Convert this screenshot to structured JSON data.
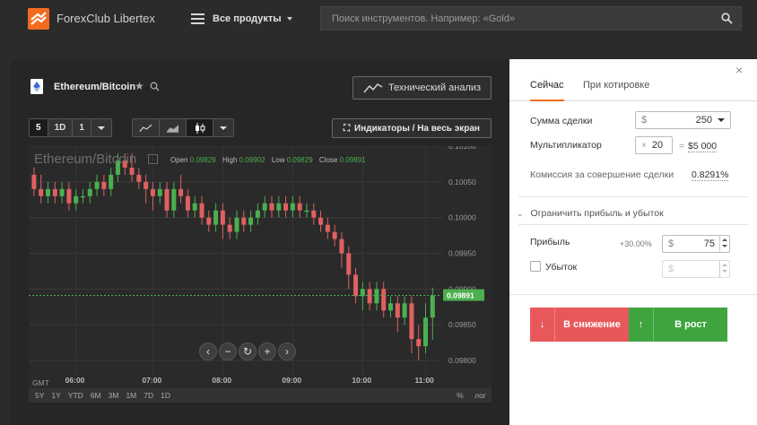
{
  "header": {
    "brand": "ForexClub Libertex",
    "products_label": "Все продукты",
    "search_placeholder": "Поиск инструментов. Например: «Gold»"
  },
  "instrument": {
    "name": "Ethereum/Bitcoin",
    "tech_analysis_label": "Технический анализ",
    "indicators_label": "Индикаторы / На весь экран"
  },
  "timeframes": [
    "5",
    "1D",
    "1"
  ],
  "chart": {
    "watermark": "Ethereum/Bitcoin",
    "ohlc": {
      "open_label": "Open",
      "open": "0.09829",
      "high_label": "High",
      "high": "0.09902",
      "low_label": "Low",
      "low": "0.09829",
      "close_label": "Close",
      "close": "0.09891"
    },
    "gmt_label": "GMT",
    "ranges": [
      "5Y",
      "1Y",
      "YTD",
      "6M",
      "3M",
      "1M",
      "7D",
      "1D"
    ],
    "right_controls": [
      "%",
      "лог"
    ],
    "colors": {
      "up": "#4caf50",
      "down": "#e06060",
      "last_price_line": "#4caf50"
    }
  },
  "chart_data": {
    "type": "candlestick",
    "title": "Ethereum/Bitcoin",
    "y_ticks": [
      "0.10100",
      "0.10050",
      "0.10000",
      "0.09950",
      "0.09900",
      "0.09850",
      "0.09800"
    ],
    "x_ticks": [
      "06:00",
      "07:00",
      "08:00",
      "09:00",
      "10:00",
      "11:00"
    ],
    "ylim": [
      0.0978,
      0.101
    ],
    "last_price": "0.09891",
    "grid": true,
    "candles": [
      [
        0.1006,
        0.1004,
        0.1007,
        0.1003
      ],
      [
        0.1004,
        0.1003,
        0.1006,
        0.1002
      ],
      [
        0.1003,
        0.1004,
        0.1005,
        0.1002
      ],
      [
        0.1004,
        0.1003,
        0.1005,
        0.1002
      ],
      [
        0.1003,
        0.1004,
        0.1005,
        0.1002
      ],
      [
        0.1004,
        0.1002,
        0.1005,
        0.1001
      ],
      [
        0.1002,
        0.1003,
        0.1004,
        0.1001
      ],
      [
        0.1003,
        0.1003,
        0.1004,
        0.1002
      ],
      [
        0.1003,
        0.1004,
        0.1005,
        0.1002
      ],
      [
        0.1004,
        0.1005,
        0.1006,
        0.1003
      ],
      [
        0.1005,
        0.1004,
        0.1006,
        0.1003
      ],
      [
        0.1004,
        0.1006,
        0.1007,
        0.1003
      ],
      [
        0.1006,
        0.1008,
        0.1009,
        0.1005
      ],
      [
        0.1008,
        0.1007,
        0.1009,
        0.1006
      ],
      [
        0.1007,
        0.1006,
        0.1009,
        0.1005
      ],
      [
        0.1006,
        0.1005,
        0.1007,
        0.1004
      ],
      [
        0.1005,
        0.1004,
        0.1006,
        0.1002
      ],
      [
        0.1004,
        0.1003,
        0.1005,
        0.1001
      ],
      [
        0.1003,
        0.1004,
        0.1005,
        0.1002
      ],
      [
        0.1004,
        0.1001,
        0.1005,
        0.1
      ],
      [
        0.1001,
        0.1004,
        0.1005,
        0.1
      ],
      [
        0.1004,
        0.1003,
        0.1006,
        0.1002
      ],
      [
        0.1003,
        0.1001,
        0.1004,
        0.1
      ],
      [
        0.1001,
        0.1002,
        0.1003,
        0.1
      ],
      [
        0.1002,
        0.1,
        0.1003,
        0.0999
      ],
      [
        0.1,
        0.0999,
        0.1001,
        0.0998
      ],
      [
        0.0999,
        0.1001,
        0.1002,
        0.0998
      ],
      [
        0.1001,
        0.0999,
        0.1002,
        0.0997
      ],
      [
        0.0999,
        0.0998,
        0.1,
        0.0997
      ],
      [
        0.0998,
        0.1,
        0.1001,
        0.0997
      ],
      [
        0.1,
        0.0999,
        0.1001,
        0.0998
      ],
      [
        0.0999,
        0.1,
        0.1001,
        0.0998
      ],
      [
        0.1,
        0.1001,
        0.1002,
        0.0999
      ],
      [
        0.1001,
        0.1002,
        0.1003,
        0.1
      ],
      [
        0.1002,
        0.1001,
        0.1003,
        0.1
      ],
      [
        0.1001,
        0.1002,
        0.1003,
        0.1
      ],
      [
        0.1002,
        0.1001,
        0.1003,
        0.1
      ],
      [
        0.1001,
        0.1002,
        0.1003,
        0.1
      ],
      [
        0.1002,
        0.1001,
        0.1003,
        0.1
      ],
      [
        0.1001,
        0.1001,
        0.1002,
        0.1
      ],
      [
        0.1001,
        0.1,
        0.1002,
        0.0999
      ],
      [
        0.1,
        0.0999,
        0.1001,
        0.0998
      ],
      [
        0.0999,
        0.0998,
        0.1,
        0.0997
      ],
      [
        0.0998,
        0.0997,
        0.0999,
        0.0996
      ],
      [
        0.0997,
        0.0995,
        0.0998,
        0.0993
      ],
      [
        0.0995,
        0.0992,
        0.0996,
        0.099
      ],
      [
        0.0992,
        0.0989,
        0.0993,
        0.0988
      ],
      [
        0.0989,
        0.099,
        0.0991,
        0.0987
      ],
      [
        0.099,
        0.0988,
        0.0991,
        0.0987
      ],
      [
        0.0988,
        0.099,
        0.0991,
        0.0987
      ],
      [
        0.099,
        0.0987,
        0.0991,
        0.0986
      ],
      [
        0.0987,
        0.0988,
        0.0989,
        0.0986
      ],
      [
        0.0988,
        0.0986,
        0.0989,
        0.0984
      ],
      [
        0.0986,
        0.0988,
        0.0989,
        0.0985
      ],
      [
        0.0988,
        0.0983,
        0.0989,
        0.0981
      ],
      [
        0.0983,
        0.0982,
        0.0985,
        0.098
      ],
      [
        0.0982,
        0.0986,
        0.0988,
        0.0981
      ],
      [
        0.0986,
        0.09891,
        0.09902,
        0.09829
      ]
    ]
  },
  "nav_controls": [
    "‹",
    "−",
    "↻",
    "+",
    "›"
  ],
  "trade": {
    "tab_now": "Сейчас",
    "tab_quote": "При котировке",
    "amount_label": "Сумма сделки",
    "amount_currency": "$",
    "amount_value": "250",
    "multiplier_label": "Мультипликатор",
    "multiplier_x": "×",
    "multiplier_value": "20",
    "multiplier_eq": "=",
    "multiplier_total": "$5 000",
    "commission_label": "Комиссия за совершение сделки",
    "commission_value": "0.8291%",
    "limit_label": "Ограничить прибыль и убыток",
    "profit_label": "Прибыль",
    "profit_pct": "+30.00%",
    "profit_currency": "$",
    "profit_value": "75",
    "loss_label": "Убыток",
    "loss_currency": "$",
    "sell_label": "В снижение",
    "buy_label": "В рост"
  }
}
